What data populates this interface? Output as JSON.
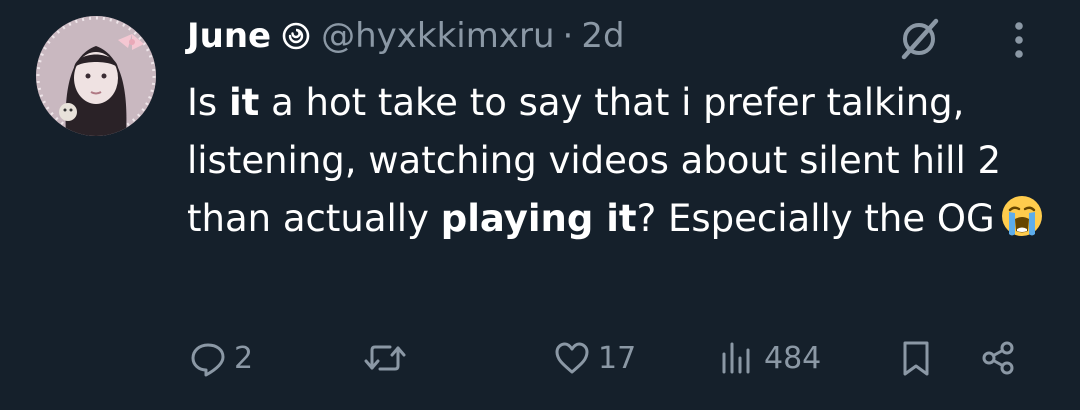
{
  "author": {
    "name": "June",
    "badge_icon": "spiral-icon",
    "handle": "@hyxkkimxru",
    "separator": "·",
    "time": "2d"
  },
  "tweet": {
    "text_parts": [
      "Is ",
      "it",
      " a hot take to say that i prefer talking, listening, watching videos about silent hill 2 than actually ",
      "playing it",
      "? Especially the OG"
    ],
    "emoji_icon": "loudly-crying-face-emoji"
  },
  "actions": {
    "reply_count": "2",
    "retweet_count": "",
    "like_count": "17",
    "views_count": "484"
  },
  "colors": {
    "background": "#15202b",
    "text": "#ffffff",
    "muted": "#8b98a5"
  }
}
